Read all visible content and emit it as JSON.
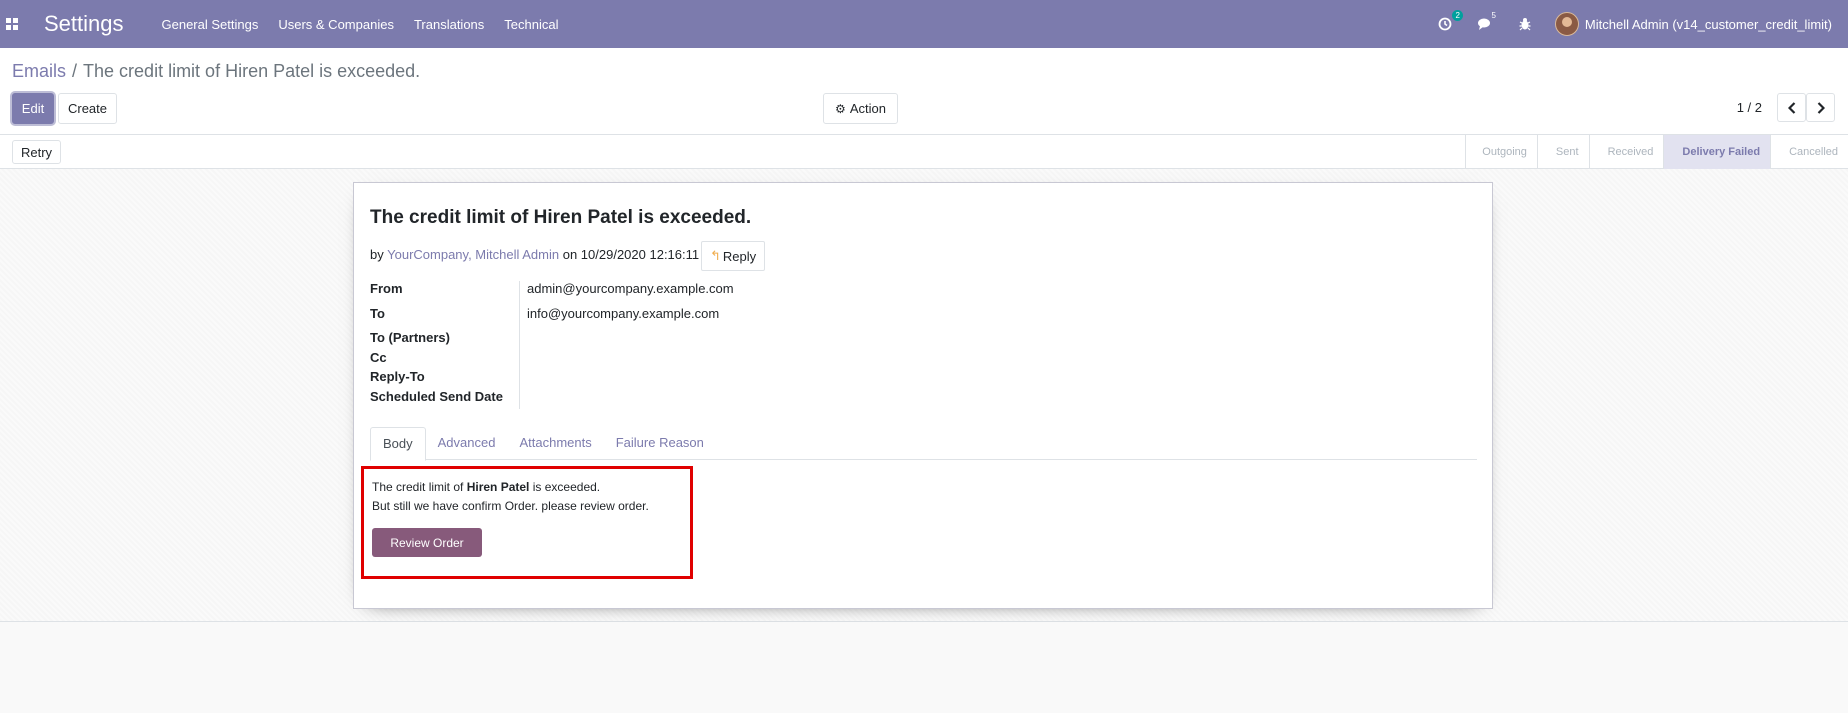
{
  "navbar": {
    "app_title": "Settings",
    "menu": [
      "General Settings",
      "Users & Companies",
      "Translations",
      "Technical"
    ],
    "activity_count": "2",
    "messages_count": "5",
    "user_name": "Mitchell Admin (v14_customer_credit_limit)",
    "colors": {
      "navbar_bg": "#7c7bad",
      "badge": "#00a09d"
    }
  },
  "breadcrumb": {
    "parent": "Emails",
    "separator": "/",
    "current": "The credit limit of Hiren Patel is exceeded."
  },
  "buttons": {
    "edit": "Edit",
    "create": "Create",
    "action": "Action",
    "retry": "Retry"
  },
  "pager": {
    "value": "1 / 2"
  },
  "statusbar": {
    "steps": [
      "Outgoing",
      "Sent",
      "Received",
      "Delivery Failed",
      "Cancelled"
    ],
    "active": "Delivery Failed"
  },
  "mail": {
    "subject": "The credit limit of Hiren Patel is exceeded.",
    "by_prefix": "by",
    "authors": "YourCompany, Mitchell Admin",
    "on_text": "on 10/29/2020 12:16:11",
    "reply_label": "Reply",
    "fields": [
      {
        "label": "From",
        "value": "admin@yourcompany.example.com"
      },
      {
        "label": "To",
        "value": "info@yourcompany.example.com"
      },
      {
        "label": "To (Partners)",
        "value": ""
      },
      {
        "label": "Cc",
        "value": ""
      },
      {
        "label": "Reply-To",
        "value": ""
      },
      {
        "label": "Scheduled Send Date",
        "value": ""
      }
    ],
    "tabs": [
      "Body",
      "Advanced",
      "Attachments",
      "Failure Reason"
    ],
    "active_tab": "Body",
    "body": {
      "line1_prefix": "The credit limit of",
      "line1_name": "Hiren Patel",
      "line1_suffix": "is exceeded.",
      "line2": "But still we have confirm Order. please review order.",
      "button": "Review Order"
    }
  }
}
